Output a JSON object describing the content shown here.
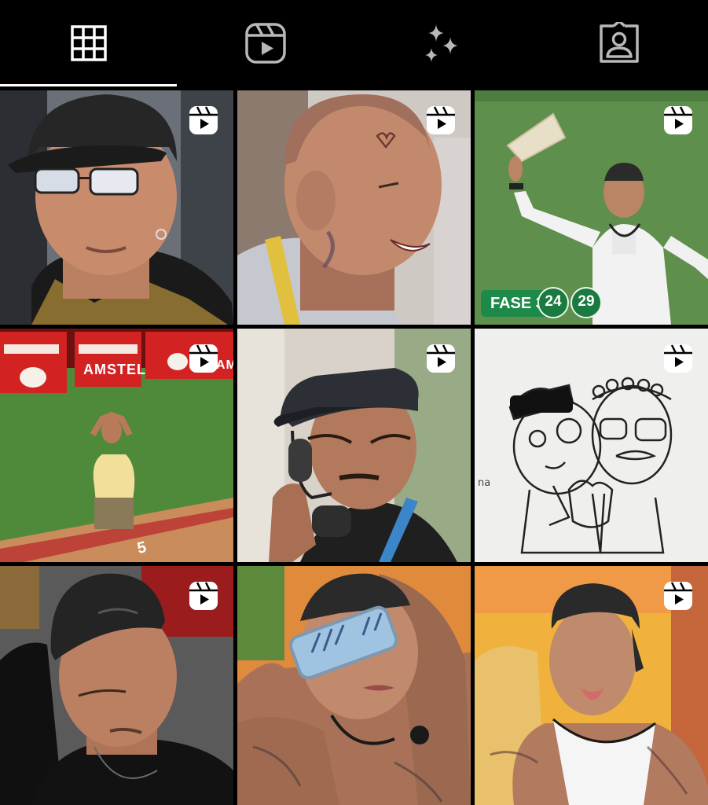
{
  "tabs": [
    {
      "icon": "grid-icon",
      "active": true
    },
    {
      "icon": "reels-icon",
      "active": false
    },
    {
      "icon": "sparkles-icon",
      "active": false
    },
    {
      "icon": "tagged-person-icon",
      "active": false
    }
  ],
  "posts": [
    {
      "type": "reel",
      "subject": "man-black-cap-tinted-glasses"
    },
    {
      "type": "reel",
      "subject": "bald-man-face-tattoos-laughing"
    },
    {
      "type": "reel",
      "subject": "man-white-shirt-raising-hand-on-grass",
      "overlay": {
        "phase_label": "FASE 3",
        "score_left": "24",
        "score_right": "29"
      }
    },
    {
      "type": "reel",
      "subject": "man-kneeling-on-field",
      "overlay": {
        "sponsor": "AMSTEL",
        "sponsor_secondary": "AM",
        "field_number": "5"
      }
    },
    {
      "type": "reel",
      "subject": "man-cap-on-phone"
    },
    {
      "type": "reel",
      "subject": "sketch-two-characters",
      "overlay": {
        "caption_fragment": "na"
      }
    },
    {
      "type": "reel",
      "subject": "man-backwards-cap-black-shirt"
    },
    {
      "type": "reel",
      "subject": "tattooed-man-blue-sunglasses"
    },
    {
      "type": "reel",
      "subject": "man-backwards-cap-tongue-out"
    }
  ],
  "colors": {
    "background": "#000000",
    "active_indicator": "#ffffff",
    "icon": "#ffffff",
    "score_green": "#1b7a3f"
  }
}
